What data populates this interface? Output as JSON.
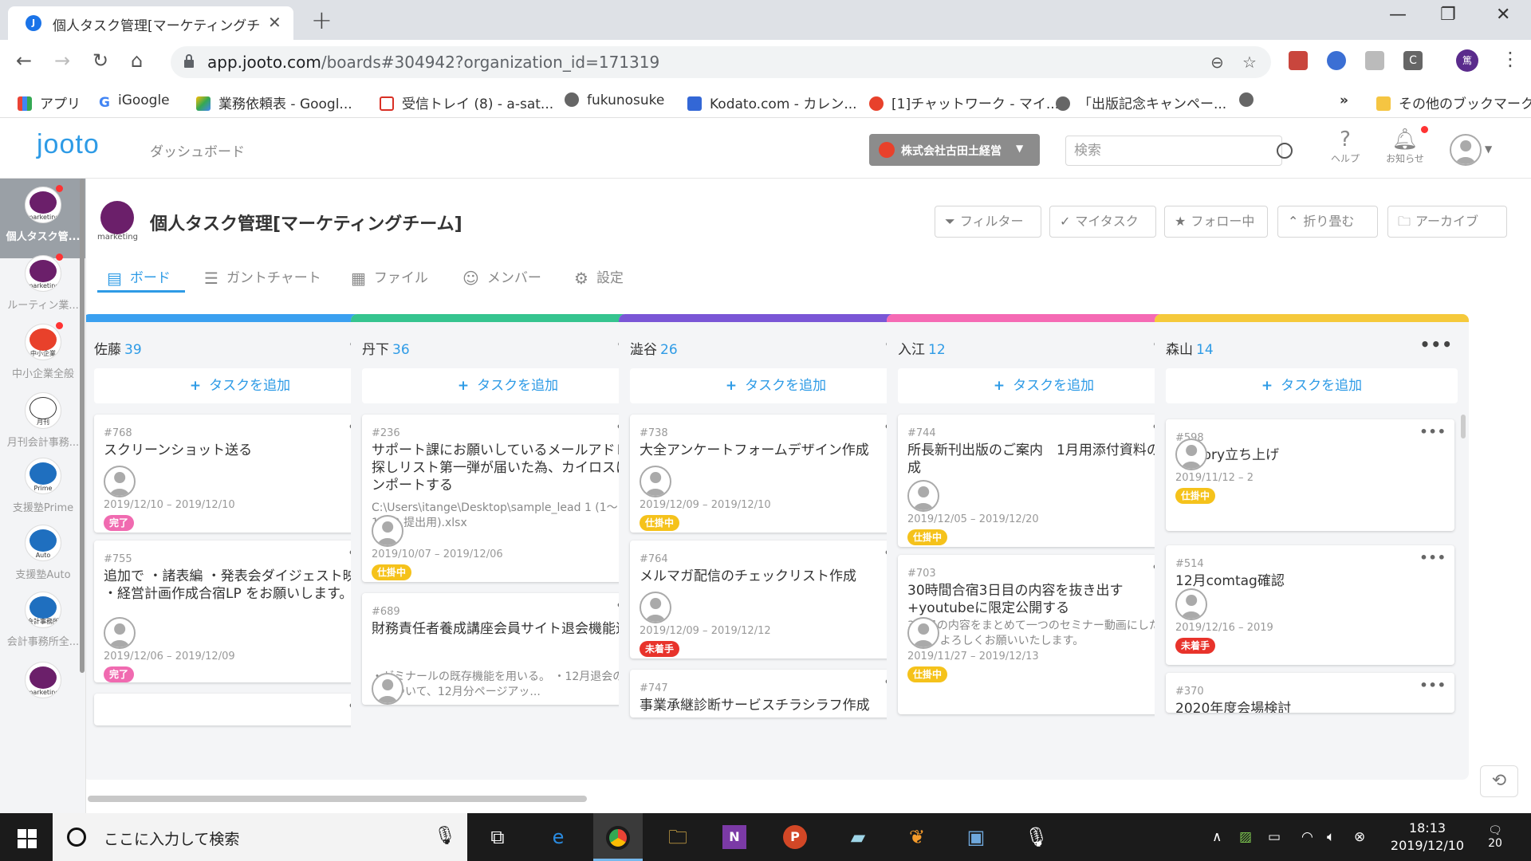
{
  "browser": {
    "tab_title": "個人タスク管理[マーケティングチーム]",
    "url_host": "app.jooto.com",
    "url_path": "/boards#304942?organization_id=171319",
    "bookmarks": [
      "アプリ",
      "iGoogle",
      "業務依頼表 - Googl...",
      "受信トレイ (8) - a-sat...",
      "fukunosuke",
      "Kodato.com - カレン...",
      "[1]チャットワーク - マイ...",
      "「出版記念キャンペー...",
      "その他のブックマーク"
    ],
    "ext_avatar_text": "篤"
  },
  "header": {
    "logo": "jooto",
    "dashboard": "ダッシュボード",
    "org_name": "株式会社古田土経営",
    "search_placeholder": "検索",
    "help": "ヘルプ",
    "notifications": "お知らせ"
  },
  "rail": {
    "items": [
      {
        "label": "個人タスク管...",
        "sub": "marketing",
        "color": "#6b1f6a"
      },
      {
        "label": "ルーティン業...",
        "sub": "marketing",
        "color": "#6b1f6a"
      },
      {
        "label": "中小企業全般",
        "sub": "中小企業",
        "color": "#e8412b"
      },
      {
        "label": "月刊会計事務...",
        "sub": "月刊",
        "color": "#ffffff"
      },
      {
        "label": "支援塾Prime",
        "sub": "Prime",
        "color": "#1f6fbf"
      },
      {
        "label": "支援塾Auto",
        "sub": "Auto",
        "color": "#1f6fbf"
      },
      {
        "label": "会計事務所全...",
        "sub": "会計事務所",
        "color": "#1f6fbf"
      },
      {
        "label": "",
        "sub": "marketing",
        "color": "#6b1f6a"
      }
    ]
  },
  "project": {
    "logo_text": "marketing",
    "title": "個人タスク管理[マーケティングチーム]",
    "buttons": [
      "フィルター",
      "マイタスク",
      "フォロー中",
      "折り畳む",
      "アーカイブ"
    ]
  },
  "views": [
    "ボード",
    "ガントチャート",
    "ファイル",
    "メンバー",
    "設定"
  ],
  "board": {
    "add_task_label": "タスクを追加",
    "columns": [
      {
        "name": "佐藤",
        "count": "39",
        "color": "#3aa0f0",
        "cards": [
          {
            "num": "#768",
            "title": "スクリーンショット送る",
            "desc": "",
            "date": "2019/12/10 – 2019/12/10",
            "status": "完了"
          },
          {
            "num": "#755",
            "title": "追加で ・諸表編 ・発表会ダイジェスト映像 ・経営計画作成合宿LP をお願いします。",
            "desc": "",
            "date": "2019/12/06 – 2019/12/09",
            "status": "完了"
          },
          {
            "num": "",
            "title": "",
            "desc": "",
            "date": "",
            "status": ""
          }
        ]
      },
      {
        "name": "丹下",
        "count": "36",
        "color": "#35c48f",
        "cards": [
          {
            "num": "#236",
            "title": "サポート課にお願いしているメールアドレス探しリスト第一弾が届いた為、カイロスにインポートする",
            "desc": "C:\\Users\\itange\\Desktop\\sample_lead 1 (1～1000 提出用).xlsx",
            "date": "2019/10/07 – 2019/12/06",
            "status": "仕掛中"
          },
          {
            "num": "#689",
            "title": "財務責任者養成講座会員サイト退会機能追加",
            "desc": "・ゼミナールの既存機能を用いる。 ・12月退会の扱いについて、12月分ページアッ...",
            "date": "",
            "status": ""
          }
        ]
      },
      {
        "name": "澁谷",
        "count": "26",
        "color": "#7a56d6",
        "cards": [
          {
            "num": "#738",
            "title": "大全アンケートフォームデザイン作成",
            "desc": "",
            "date": "2019/12/09 – 2019/12/10",
            "status": "仕掛中"
          },
          {
            "num": "#764",
            "title": "メルマガ配信のチェックリスト作成",
            "desc": "",
            "date": "2019/12/09 – 2019/12/12",
            "status": "未着手"
          },
          {
            "num": "#747",
            "title": "事業承継診断サービスチラシラフ作成",
            "desc": "",
            "date": "",
            "status": ""
          }
        ]
      },
      {
        "name": "入江",
        "count": "12",
        "color": "#f56ab4",
        "cards": [
          {
            "num": "#744",
            "title": "所長新刊出版のご案内　1月用添付資料の作成",
            "desc": "",
            "date": "2019/12/05 – 2019/12/20",
            "status": "仕掛中"
          },
          {
            "num": "#703",
            "title": "30時間合宿3日目の内容を抜き出す+youtubeに限定公開する",
            "desc": "3日目の内容をまとめて一つのセミナー動画にしたいです。よろしくお願いいたします。",
            "date": "2019/11/27 – 2019/12/13",
            "status": "仕掛中"
          }
        ]
      },
      {
        "name": "森山",
        "count": "14",
        "color": "#f5c93b",
        "cards": [
          {
            "num": "#598",
            "title": "Factory立ち上げ",
            "desc": "",
            "date": "2019/11/12 – 2",
            "status": "仕掛中"
          },
          {
            "num": "#514",
            "title": "12月comtag確認",
            "desc": "",
            "date": "2019/12/16 – 2019",
            "status": "未着手"
          },
          {
            "num": "#370",
            "title": "2020年度会場検討",
            "desc": "",
            "date": "",
            "status": ""
          }
        ]
      }
    ]
  },
  "status_colors": {
    "完了": "#f06ab0",
    "仕掛中": "#f5c21b",
    "未着手": "#e8332b"
  },
  "taskbar": {
    "search_text": "ここに入力して検索",
    "time": "18:13",
    "date": "2019/12/10",
    "notif_count": "20"
  }
}
